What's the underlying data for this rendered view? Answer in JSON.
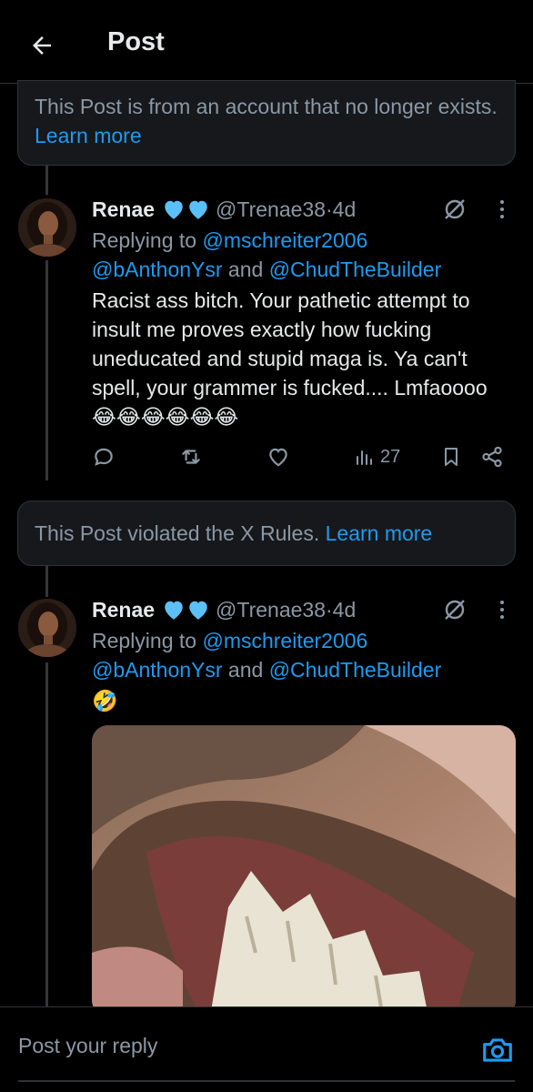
{
  "header": {
    "title": "Post",
    "back_icon": "arrow-left-icon"
  },
  "notices": [
    {
      "text": "This Post is from an account that no longer exists. ",
      "link": "Learn more"
    },
    {
      "text": "This Post violated the X Rules. ",
      "link": "Learn more"
    }
  ],
  "tweets": [
    {
      "name": "Renae",
      "badges": "blue-heart-icon x2",
      "handle": "@Trenae38",
      "sep": " · ",
      "time": "4d",
      "replying_prefix": "Replying to ",
      "replying_to_1": "@mschreiter2006",
      "replying_to_2": "@bAnthonYsr",
      "replying_and": " and ",
      "replying_to_3": "@ChudTheBuilder",
      "text": "Racist ass bitch. Your pathetic attempt to insult me proves exactly how fucking uneducated and stupid maga is. Ya can't spell, your grammer is fucked.... Lmfaoooo",
      "emoji": "😂😂😂😂😂😂",
      "views": "27"
    },
    {
      "name": "Renae",
      "badges": "blue-heart-icon x2",
      "handle": "@Trenae38",
      "sep": " · ",
      "time": "4d",
      "replying_prefix": "Replying to ",
      "replying_to_1": "@mschreiter2006",
      "replying_to_2": "@bAnthonYsr",
      "replying_and": " and ",
      "replying_to_3": "@ChudTheBuilder",
      "emoji": "🤣"
    }
  ],
  "reply_bar": {
    "placeholder": "Post your reply",
    "camera_icon": "camera-icon"
  },
  "colors": {
    "accent": "#1d9bf0",
    "background": "#000000",
    "muted": "#8b98a5",
    "heart": "#5bc0f8"
  }
}
